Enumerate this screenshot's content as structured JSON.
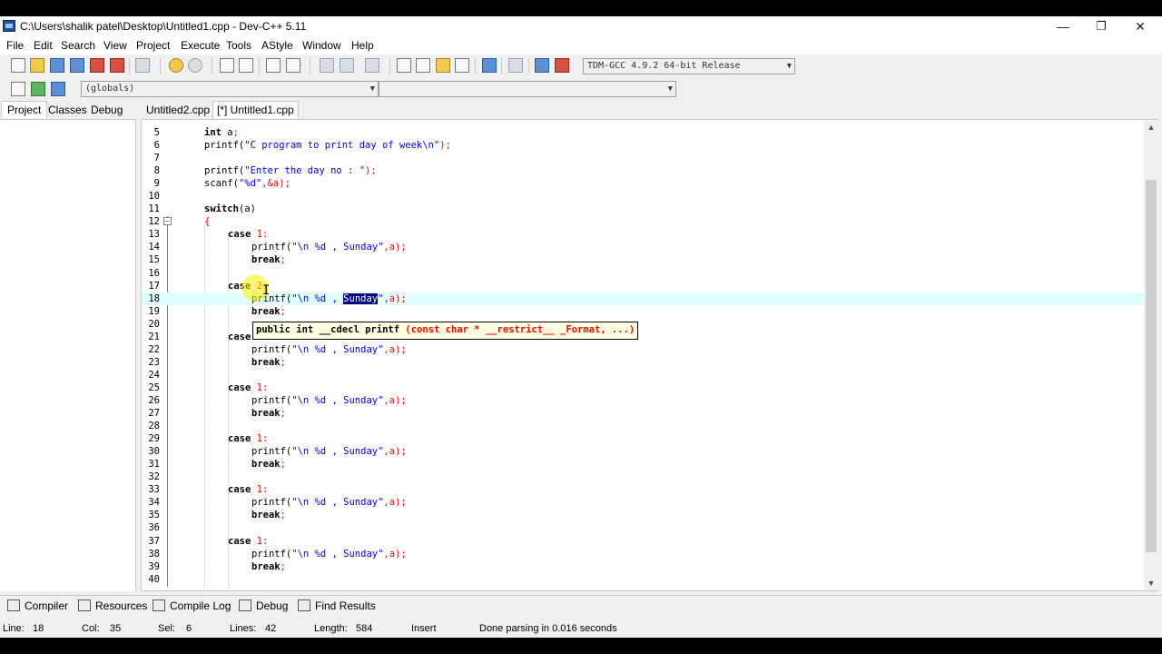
{
  "window": {
    "title": "C:\\Users\\shalik patel\\Desktop\\Untitled1.cpp - Dev-C++ 5.11",
    "minimize": "—",
    "restore": "❐",
    "close": "✕"
  },
  "menu": [
    "File",
    "Edit",
    "Search",
    "View",
    "Project",
    "Execute",
    "Tools",
    "AStyle",
    "Window",
    "Help"
  ],
  "toolbar": {
    "compiler_select": "TDM-GCC 4.9.2 64-bit Release",
    "scope_select": "(globals)",
    "symbol_select": ""
  },
  "left_tabs": [
    "Project",
    "Classes",
    "Debug"
  ],
  "file_tabs": [
    "Untitled2.cpp",
    "[*] Untitled1.cpp"
  ],
  "editor": {
    "lines": [
      {
        "n": "5",
        "indent": 0,
        "parts": [
          {
            "t": "int",
            "c": "kw"
          },
          {
            "t": " a",
            "c": ""
          },
          {
            "t": ";",
            "c": "sym"
          }
        ]
      },
      {
        "n": "6",
        "indent": 0,
        "parts": [
          {
            "t": "printf(",
            "c": ""
          },
          {
            "t": "\"C program to print day of week\\n\"",
            "c": "str"
          },
          {
            "t": ");",
            "c": "sym"
          }
        ]
      },
      {
        "n": "7",
        "indent": 0,
        "parts": []
      },
      {
        "n": "8",
        "indent": 0,
        "parts": [
          {
            "t": "printf(",
            "c": ""
          },
          {
            "t": "\"Enter the day no : \"",
            "c": "str"
          },
          {
            "t": ");",
            "c": "sym"
          }
        ]
      },
      {
        "n": "9",
        "indent": 0,
        "parts": [
          {
            "t": "scanf(",
            "c": ""
          },
          {
            "t": "\"%d\"",
            "c": "str"
          },
          {
            "t": ",&a);",
            "c": "sym"
          }
        ]
      },
      {
        "n": "10",
        "indent": 0,
        "parts": []
      },
      {
        "n": "11",
        "indent": 0,
        "parts": [
          {
            "t": "switch",
            "c": "kw"
          },
          {
            "t": "(a)",
            "c": ""
          }
        ]
      },
      {
        "n": "12",
        "indent": 0,
        "parts": [
          {
            "t": "{",
            "c": "sym"
          }
        ]
      },
      {
        "n": "13",
        "indent": 1,
        "parts": [
          {
            "t": "case",
            "c": "kw"
          },
          {
            "t": " ",
            "c": ""
          },
          {
            "t": "1",
            "c": "num"
          },
          {
            "t": ":",
            "c": "sym"
          }
        ]
      },
      {
        "n": "14",
        "indent": 2,
        "parts": [
          {
            "t": "printf(",
            "c": ""
          },
          {
            "t": "\"\\n %d , Sunday\"",
            "c": "str"
          },
          {
            "t": ",a);",
            "c": "sym"
          }
        ]
      },
      {
        "n": "15",
        "indent": 2,
        "parts": [
          {
            "t": "break",
            "c": "kw"
          },
          {
            "t": ";",
            "c": "sym"
          }
        ]
      },
      {
        "n": "16",
        "indent": 0,
        "parts": []
      },
      {
        "n": "17",
        "indent": 1,
        "parts": [
          {
            "t": "case",
            "c": "kw"
          },
          {
            "t": " ",
            "c": ""
          },
          {
            "t": "2",
            "c": "num"
          },
          {
            "t": ":",
            "c": "sym"
          }
        ]
      },
      {
        "n": "18",
        "indent": 2,
        "hl": true,
        "parts": [
          {
            "t": "printf(",
            "c": ""
          },
          {
            "t": "\"\\n %d , ",
            "c": "str"
          },
          {
            "t": "Sunday",
            "c": "sel"
          },
          {
            "t": "\"",
            "c": "str"
          },
          {
            "t": ",a);",
            "c": "sym"
          }
        ]
      },
      {
        "n": "19",
        "indent": 2,
        "parts": [
          {
            "t": "break",
            "c": "kw"
          },
          {
            "t": ";",
            "c": "sym"
          }
        ]
      },
      {
        "n": "20",
        "indent": 0,
        "parts": []
      },
      {
        "n": "21",
        "indent": 1,
        "parts": [
          {
            "t": "case",
            "c": "kw"
          },
          {
            "t": " ",
            "c": ""
          },
          {
            "t": "1",
            "c": "num"
          },
          {
            "t": ":",
            "c": "sym"
          }
        ]
      },
      {
        "n": "22",
        "indent": 2,
        "parts": [
          {
            "t": "printf(",
            "c": ""
          },
          {
            "t": "\"\\n %d , Sunday\"",
            "c": "str"
          },
          {
            "t": ",a);",
            "c": "sym"
          }
        ]
      },
      {
        "n": "23",
        "indent": 2,
        "parts": [
          {
            "t": "break",
            "c": "kw"
          },
          {
            "t": ";",
            "c": "sym"
          }
        ]
      },
      {
        "n": "24",
        "indent": 0,
        "parts": []
      },
      {
        "n": "25",
        "indent": 1,
        "parts": [
          {
            "t": "case",
            "c": "kw"
          },
          {
            "t": " ",
            "c": ""
          },
          {
            "t": "1",
            "c": "num"
          },
          {
            "t": ":",
            "c": "sym"
          }
        ]
      },
      {
        "n": "26",
        "indent": 2,
        "parts": [
          {
            "t": "printf(",
            "c": ""
          },
          {
            "t": "\"\\n %d , Sunday\"",
            "c": "str"
          },
          {
            "t": ",a);",
            "c": "sym"
          }
        ]
      },
      {
        "n": "27",
        "indent": 2,
        "parts": [
          {
            "t": "break",
            "c": "kw"
          },
          {
            "t": ";",
            "c": "sym"
          }
        ]
      },
      {
        "n": "28",
        "indent": 0,
        "parts": []
      },
      {
        "n": "29",
        "indent": 1,
        "parts": [
          {
            "t": "case",
            "c": "kw"
          },
          {
            "t": " ",
            "c": ""
          },
          {
            "t": "1",
            "c": "num"
          },
          {
            "t": ":",
            "c": "sym"
          }
        ]
      },
      {
        "n": "30",
        "indent": 2,
        "parts": [
          {
            "t": "printf(",
            "c": ""
          },
          {
            "t": "\"\\n %d , Sunday\"",
            "c": "str"
          },
          {
            "t": ",a);",
            "c": "sym"
          }
        ]
      },
      {
        "n": "31",
        "indent": 2,
        "parts": [
          {
            "t": "break",
            "c": "kw"
          },
          {
            "t": ";",
            "c": "sym"
          }
        ]
      },
      {
        "n": "32",
        "indent": 0,
        "parts": []
      },
      {
        "n": "33",
        "indent": 1,
        "parts": [
          {
            "t": "case",
            "c": "kw"
          },
          {
            "t": " ",
            "c": ""
          },
          {
            "t": "1",
            "c": "num"
          },
          {
            "t": ":",
            "c": "sym"
          }
        ]
      },
      {
        "n": "34",
        "indent": 2,
        "parts": [
          {
            "t": "printf(",
            "c": ""
          },
          {
            "t": "\"\\n %d , Sunday\"",
            "c": "str"
          },
          {
            "t": ",a);",
            "c": "sym"
          }
        ]
      },
      {
        "n": "35",
        "indent": 2,
        "parts": [
          {
            "t": "break",
            "c": "kw"
          },
          {
            "t": ";",
            "c": "sym"
          }
        ]
      },
      {
        "n": "36",
        "indent": 0,
        "parts": []
      },
      {
        "n": "37",
        "indent": 1,
        "parts": [
          {
            "t": "case",
            "c": "kw"
          },
          {
            "t": " ",
            "c": ""
          },
          {
            "t": "1",
            "c": "num"
          },
          {
            "t": ":",
            "c": "sym"
          }
        ]
      },
      {
        "n": "38",
        "indent": 2,
        "parts": [
          {
            "t": "printf(",
            "c": ""
          },
          {
            "t": "\"\\n %d , Sunday\"",
            "c": "str"
          },
          {
            "t": ",a);",
            "c": "sym"
          }
        ]
      },
      {
        "n": "39",
        "indent": 2,
        "parts": [
          {
            "t": "break",
            "c": "kw"
          },
          {
            "t": ";",
            "c": "sym"
          }
        ]
      },
      {
        "n": "40",
        "indent": 0,
        "parts": []
      }
    ],
    "tooltip_pre": "public int __cdecl printf ",
    "tooltip_args": "(const char * __restrict__ _Format, ...)",
    "highlight_color": "#e0ffff"
  },
  "bottom_tabs": [
    {
      "label": "Compiler",
      "icon": "compiler-icon"
    },
    {
      "label": "Resources",
      "icon": "resources-icon"
    },
    {
      "label": "Compile Log",
      "icon": "compile-log-icon"
    },
    {
      "label": "Debug",
      "icon": "debug-icon"
    },
    {
      "label": "Find Results",
      "icon": "find-results-icon"
    }
  ],
  "status": {
    "line_label": "Line:",
    "line_value": "18",
    "col_label": "Col:",
    "col_value": "35",
    "sel_label": "Sel:",
    "sel_value": "6",
    "lines_label": "Lines:",
    "lines_value": "42",
    "length_label": "Length:",
    "length_value": "584",
    "mode": "Insert",
    "message": "Done parsing in 0.016 seconds"
  }
}
